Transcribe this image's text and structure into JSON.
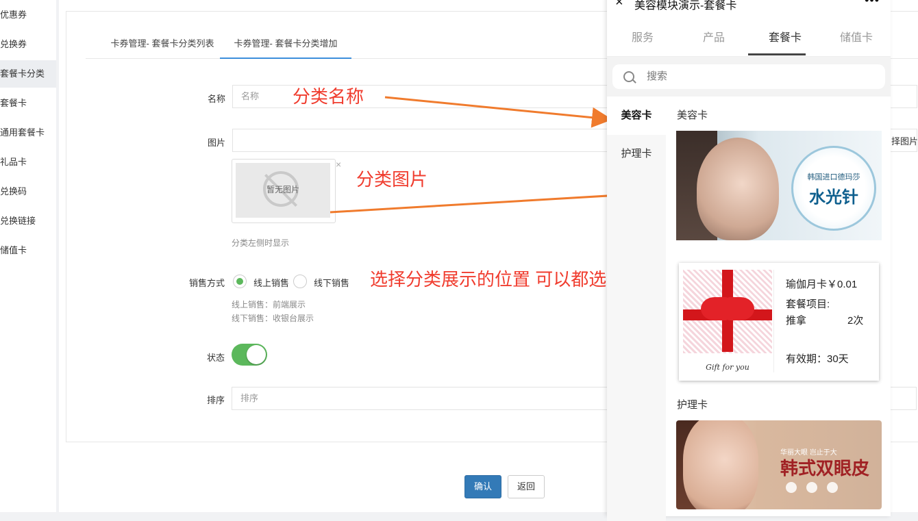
{
  "sidebar": {
    "items": [
      {
        "label": "优惠券"
      },
      {
        "label": "兑换券"
      },
      {
        "label": "套餐卡分类",
        "active": true
      },
      {
        "label": "套餐卡"
      },
      {
        "label": "通用套餐卡"
      },
      {
        "label": "礼品卡"
      },
      {
        "label": "兑换码"
      },
      {
        "label": "兑换链接"
      },
      {
        "label": "储值卡"
      }
    ]
  },
  "tabs": [
    {
      "label": "卡券管理- 套餐卡分类列表"
    },
    {
      "label": "卡券管理- 套餐卡分类增加",
      "active": true
    }
  ],
  "form": {
    "name_label": "名称",
    "name_placeholder": "名称",
    "image_label": "图片",
    "no_image_text": "暂无图片",
    "image_close": "×",
    "image_hint": "分类左侧时显示",
    "right_partial_button": "择图片",
    "sale_label": "销售方式",
    "sale_options": [
      {
        "label": "线上销售",
        "checked": true
      },
      {
        "label": "线下销售",
        "checked": false
      }
    ],
    "sale_hint_online": "线上销售：前端展示",
    "sale_hint_offline": "线下销售：收银台展示",
    "status_label": "状态",
    "status_on": true,
    "sort_label": "排序",
    "sort_placeholder": "排序",
    "confirm_label": "确认",
    "back_label": "返回"
  },
  "annotations": {
    "name": "分类名称",
    "image": "分类图片",
    "sale": "选择分类展示的位置 可以都选"
  },
  "phone": {
    "title": "美容模块演示-套餐卡",
    "close_icon": "×",
    "more_icon": "•••",
    "tabs": [
      {
        "label": "服务"
      },
      {
        "label": "产品"
      },
      {
        "label": "套餐卡",
        "active": true
      },
      {
        "label": "储值卡"
      }
    ],
    "search_placeholder": "搜索",
    "categories": [
      {
        "label": "美容卡",
        "active": true
      },
      {
        "label": "护理卡"
      }
    ],
    "section1_title": "美容卡",
    "banner1_small": "韩国进口德玛莎",
    "banner1_big": "水光针",
    "card": {
      "name_price": "瑜伽月卡￥0.01",
      "items_label": "套餐项目:",
      "item_name": "推拿",
      "item_count": "2次",
      "validity": "有效期：30天",
      "gift_text": "Gift for you"
    },
    "section2_title": "护理卡",
    "banner3_small": "华丽大眼 岂止于大",
    "banner3_big": "韩式双眼皮"
  },
  "colors": {
    "accent": "#3b8edb",
    "annotation": "#f03c2e",
    "arrow": "#f07b2d",
    "toggle_on": "#5cb85c",
    "primary_button": "#337ab7"
  }
}
